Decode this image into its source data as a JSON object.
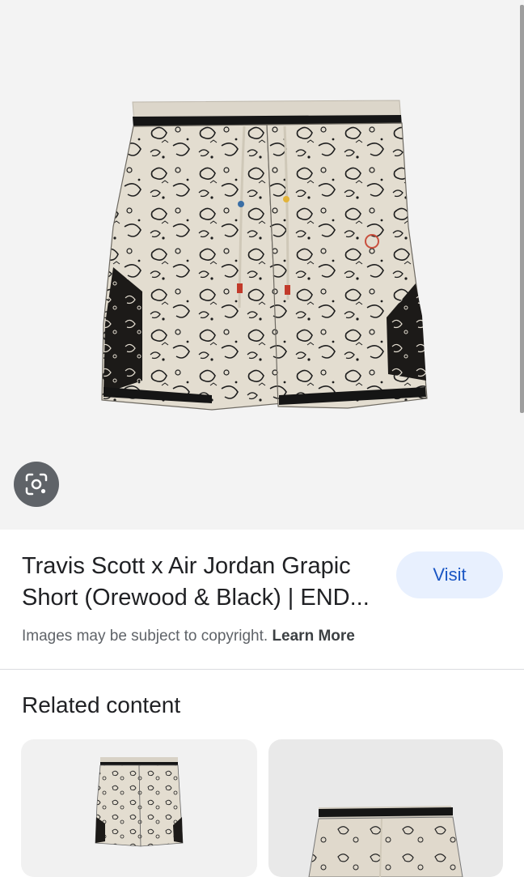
{
  "result": {
    "title": "Travis Scott x Air Jordan Grapic Short (Orewood & Black) | END...",
    "visit_label": "Visit",
    "copyright_text": "Images may be subject to copyright.",
    "learn_more_label": "Learn More"
  },
  "related": {
    "heading": "Related content"
  },
  "icons": {
    "lens": "lens-icon"
  },
  "colors": {
    "visit_bg": "#e8f0fe",
    "visit_text": "#1a56c4",
    "lens_bg": "#5f6368"
  }
}
